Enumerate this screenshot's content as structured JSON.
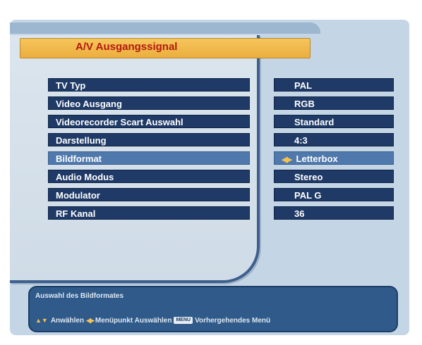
{
  "header": {
    "title": "A/V Ausgangssignal"
  },
  "menu": {
    "items": [
      {
        "label": "TV Typ",
        "value": "PAL"
      },
      {
        "label": "Video Ausgang",
        "value": "RGB"
      },
      {
        "label": "Videorecorder Scart Auswahl",
        "value": "Standard"
      },
      {
        "label": "Darstellung",
        "value": "4:3"
      },
      {
        "label": "Bildformat",
        "value": "Letterbox",
        "selected": true
      },
      {
        "label": "Audio Modus",
        "value": "Stereo"
      },
      {
        "label": "Modulator",
        "value": "PAL G"
      },
      {
        "label": "RF Kanal",
        "value": "36"
      }
    ]
  },
  "help": {
    "title": "Auswahl des Bildformates",
    "select_label": "Anwählen",
    "change_label": "Menüpunkt Auswählen",
    "menu_key": "MENU",
    "back_label": "Vorhergehendes Menü"
  },
  "colors": {
    "accent": "#ebae3e",
    "title_text": "#b31a10",
    "item_bg": "#1f3a66",
    "item_selected_bg": "#4f79ac"
  },
  "icons": {
    "selected_value_icon": "left-right-arrows-icon",
    "select_icon": "up-down-arrows-icon",
    "change_icon": "left-right-arrows-icon"
  }
}
